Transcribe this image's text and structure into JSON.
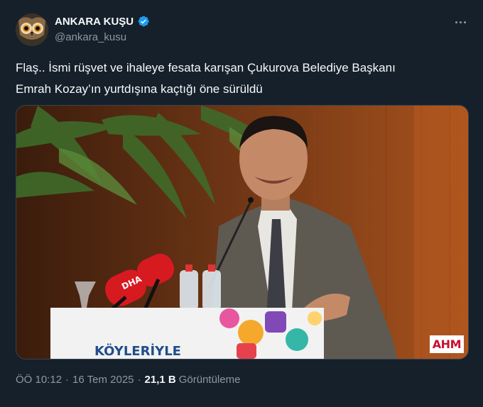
{
  "author": {
    "display_name": "ANKARA KUŞU",
    "handle": "@ankara_kusu",
    "verified": true,
    "verified_color": "#1d9bf0"
  },
  "tweet": {
    "text_line1": "Flaş.. İsmi rüşvet ve ihaleye fesata karışan Çukurova Belediye Başkanı",
    "text_line2": "Emrah Kozay’ın yurtdışına kaçtığı öne sürüldü"
  },
  "media": {
    "watermark": "AHM",
    "mic_text": "DHA",
    "podium_text": "KÖYLERİYLE"
  },
  "footer": {
    "time": "ÖÖ 10:12",
    "date": "16 Tem 2025",
    "views_count": "21,1 B",
    "views_label": "Görüntüleme"
  },
  "icons": {
    "more": "more-horizontal-icon",
    "verified": "verified-badge-icon"
  }
}
